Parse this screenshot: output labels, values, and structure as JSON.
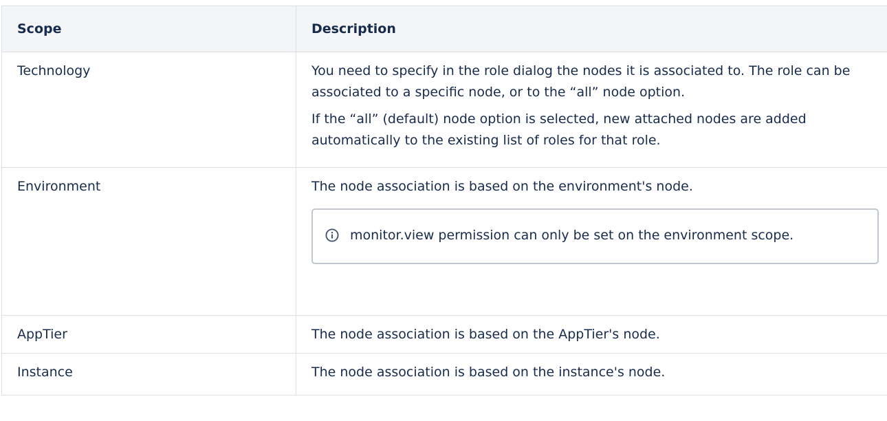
{
  "table": {
    "headers": {
      "scope": "Scope",
      "description": "Description"
    },
    "rows": [
      {
        "scope": "Technology",
        "paragraphs": [
          "You need to specify in the role dialog the nodes it is associated to. The role can be associated to a specific node, or to the “all” node option.",
          "If the “all” (default) node option is selected, new attached nodes are added automatically to the existing list of roles for that role."
        ]
      },
      {
        "scope": "Environment",
        "paragraphs": [
          "The node association is based on the environment's node."
        ],
        "info_panel": {
          "icon": "info-icon",
          "text": "monitor.view permission can only be set on the environment scope."
        }
      },
      {
        "scope": "AppTier",
        "paragraphs": [
          "The node association is based on the AppTier's node."
        ]
      },
      {
        "scope": "Instance",
        "paragraphs": [
          "The node association is based on the instance's node."
        ]
      }
    ]
  },
  "colors": {
    "text": "#172b4d",
    "header_bg": "#f4f5f7",
    "border": "#dcdfe4",
    "panel_border": "#c1c7d0",
    "info_icon": "#42526e"
  }
}
